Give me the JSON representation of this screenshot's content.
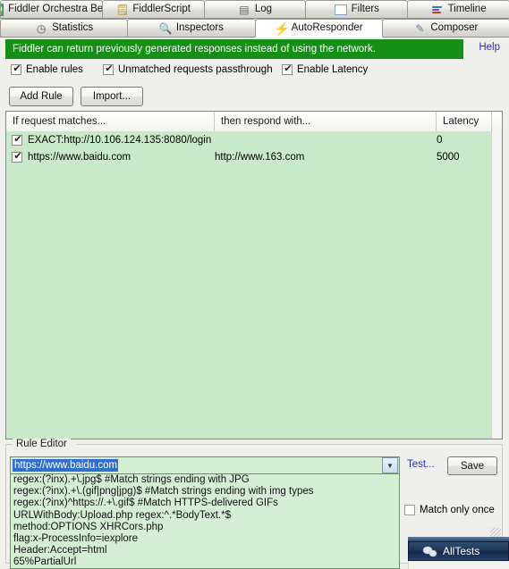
{
  "tabs_row1": [
    {
      "label": "Fiddler Orchestra Beta",
      "icon": "fo-icon",
      "selected": false
    },
    {
      "label": "FiddlerScript",
      "icon": "fiddlerscript-icon",
      "selected": false
    },
    {
      "label": "Log",
      "icon": "log-icon",
      "selected": false
    },
    {
      "label": "Filters",
      "icon": "filters-icon",
      "selected": false
    },
    {
      "label": "Timeline",
      "icon": "timeline-icon",
      "selected": false
    }
  ],
  "tabs_row2": [
    {
      "label": "Statistics",
      "icon": "stopwatch-icon",
      "selected": false
    },
    {
      "label": "Inspectors",
      "icon": "magnifier-icon",
      "selected": false
    },
    {
      "label": "AutoResponder",
      "icon": "lightning-bolt-icon",
      "selected": true
    },
    {
      "label": "Composer",
      "icon": "pencil-note-icon",
      "selected": false
    }
  ],
  "banner": {
    "text": "Fiddler can return previously generated responses instead of using the network.",
    "help_label": "Help",
    "background_color": "#168f16",
    "link_color": "#2a2ad0"
  },
  "options": [
    {
      "label": "Enable rules",
      "checked": true
    },
    {
      "label": "Unmatched requests passthrough",
      "checked": true
    },
    {
      "label": "Enable Latency",
      "checked": true
    }
  ],
  "toolbar": {
    "add_rule_label": "Add Rule",
    "import_label": "Import..."
  },
  "rules_table": {
    "columns": [
      "If request matches...",
      "then respond with...",
      "Latency"
    ],
    "rows": [
      {
        "enabled": true,
        "match": "EXACT:http://10.106.124.135:8080/login",
        "respond": "",
        "latency": "0"
      },
      {
        "enabled": true,
        "match": "https://www.baidu.com",
        "respond": "http://www.163.com",
        "latency": "5000"
      }
    ],
    "row_background_color": "#c9eac9"
  },
  "rule_editor": {
    "group_title": "Rule Editor",
    "match_value": "https://www.baidu.com",
    "match_placeholder": "https://www.baidu.com",
    "dropdown_options": [
      "regex:(?inx).+\\.jpg$ #Match strings ending with JPG",
      "regex:(?inx).+\\.(gif|png|jpg)$ #Match strings ending with img types",
      "regex:(?inx)^https://.+\\.gif$ #Match HTTPS-delivered GIFs",
      "URLWithBody:Upload.php regex:^.*BodyText.*$",
      "method:OPTIONS XHRCors.php",
      "flag:x-ProcessInfo=iexplore",
      "Header:Accept=html",
      "65%PartialUrl"
    ],
    "test_label": "Test...",
    "save_label": "Save",
    "match_only_once": {
      "label": "Match only once",
      "checked": false
    }
  },
  "taskbar": {
    "item_label": "AllTests",
    "icon": "wechat-icon"
  }
}
